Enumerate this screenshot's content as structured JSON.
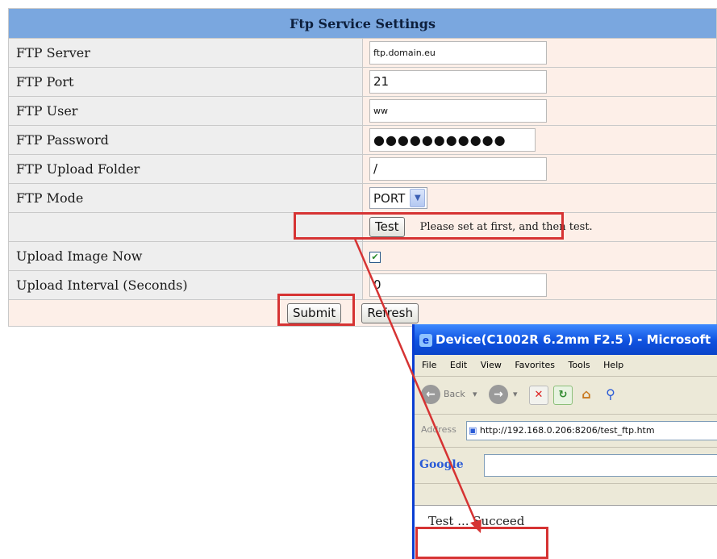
{
  "settings": {
    "title": "Ftp Service Settings",
    "rows": [
      {
        "label": "FTP Server",
        "value": "ftp.domain.eu"
      },
      {
        "label": "FTP Port",
        "value": "21"
      },
      {
        "label": "FTP User",
        "value": "ww"
      },
      {
        "label": "FTP Password",
        "value": "●●●●●●●●●●●"
      },
      {
        "label": "FTP Upload Folder",
        "value": "/"
      },
      {
        "label": "FTP Mode",
        "value": "PORT"
      }
    ],
    "test_button": "Test",
    "test_hint": "Please set at first, and then test.",
    "upload_now_label": "Upload Image Now",
    "upload_now_checked": true,
    "interval_label": "Upload Interval (Seconds)",
    "interval_value": "0",
    "submit_label": "Submit",
    "refresh_label": "Refresh"
  },
  "popup": {
    "title": "Device(C1002R 6.2mm F2.5 ) - Microsoft",
    "menu": [
      "File",
      "Edit",
      "View",
      "Favorites",
      "Tools",
      "Help"
    ],
    "back_label": "Back",
    "address_label": "Address",
    "address_url": "http://192.168.0.206:8206/test_ftp.htm",
    "google_label": "Google",
    "result_text": "Test ... Succeed"
  },
  "colors": {
    "header_bg": "#7aa7df",
    "label_bg": "#eeeeee",
    "value_bg": "#fdefe8",
    "highlight": "#d63333",
    "titlebar": "#0f52e0"
  }
}
